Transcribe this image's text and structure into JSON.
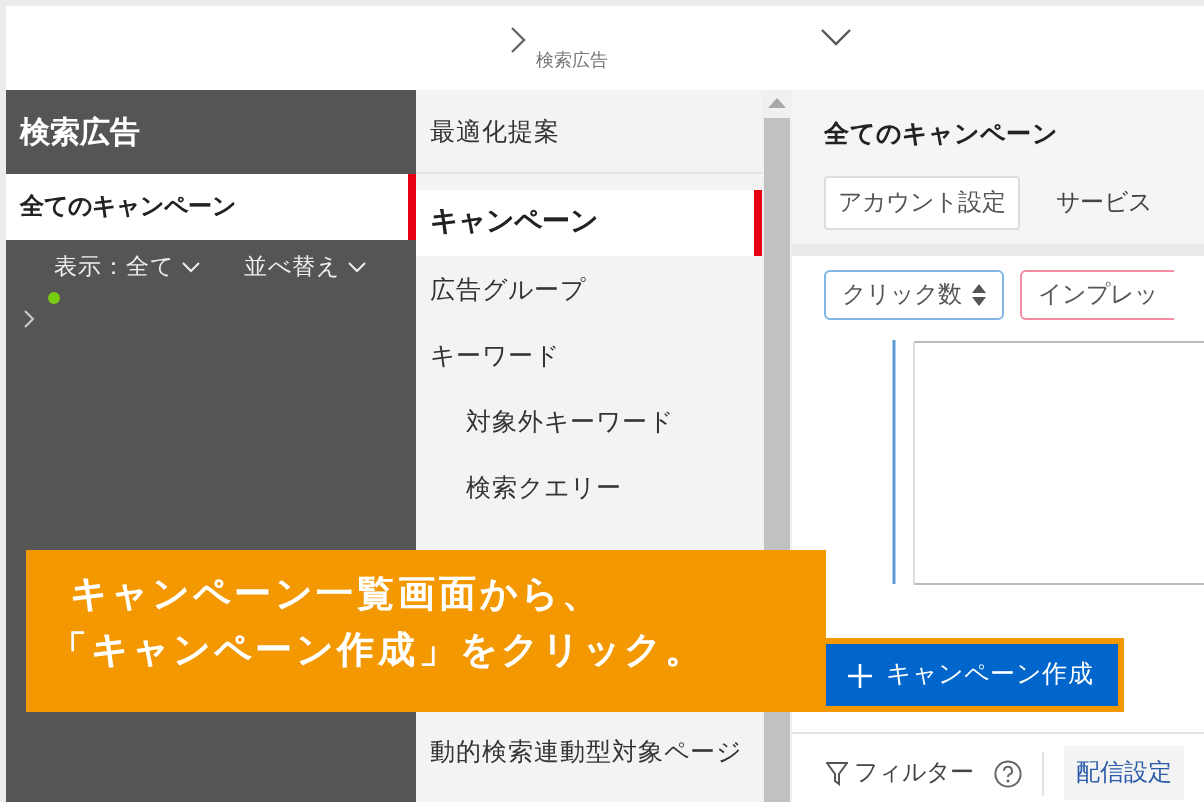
{
  "breadcrumb": {
    "label": "検索広告"
  },
  "sidebar": {
    "title": "検索広告",
    "items": [
      {
        "label": "全てのキャンペーン",
        "selected": true
      }
    ],
    "filter": "表示：全て",
    "sort": "並べ替え",
    "tree_items": [
      {
        "color": "#77cc11",
        "expanded": false
      }
    ]
  },
  "menu": {
    "items": [
      {
        "label": "最適化提案",
        "selected": false
      },
      {
        "label": "キャンペーン",
        "selected": true
      },
      {
        "label": "広告グループ",
        "selected": false
      },
      {
        "label": "キーワード",
        "selected": false,
        "children": [
          {
            "label": "対象外キーワード",
            "selected": false
          },
          {
            "label": "検索クエリー",
            "selected": false
          }
        ]
      },
      {
        "label": "動的検索連動型対象ページ",
        "selected": false
      }
    ]
  },
  "main": {
    "title": "全てのキャンペーン",
    "tabs": [
      {
        "label": "アカウント設定",
        "kind": "button"
      },
      {
        "label": "サービス",
        "kind": "link"
      }
    ],
    "metric_selectors": [
      {
        "label": "クリック数",
        "color": "#7fb6e6",
        "sort_icon": true
      },
      {
        "label": "インプレッ",
        "color": "#f28ca4",
        "sort_icon": false
      }
    ],
    "create_button": {
      "label": "キャンペーン作成",
      "highlighted": true
    },
    "toolbar": {
      "filter": "フィルター",
      "delivery": "配信設定"
    }
  },
  "callout": {
    "lines": [
      "キャンペーン一覧画面から、",
      "「キャンペーン作成」をクリック。"
    ]
  }
}
